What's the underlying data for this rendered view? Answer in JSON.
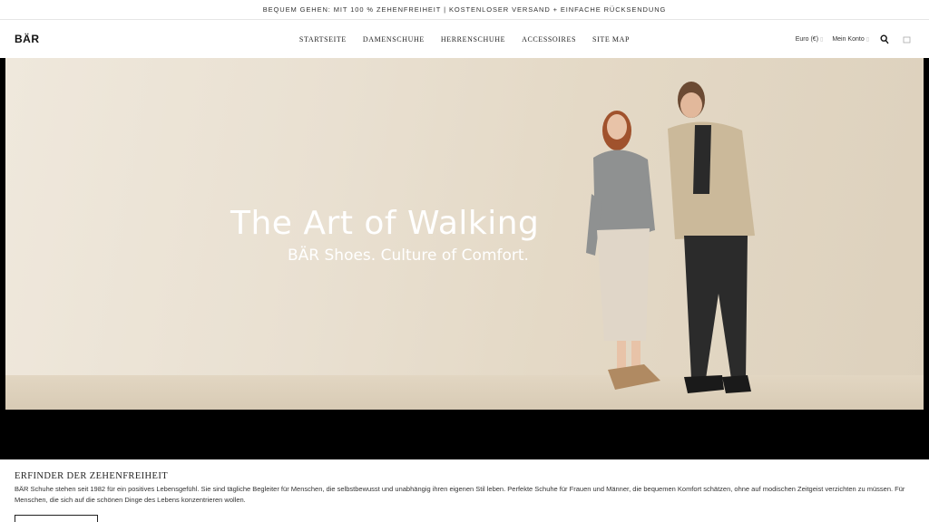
{
  "topbar": {
    "text": "BEQUEM GEHEN: MIT 100 % ZEHENFREIHEIT | KOSTENLOSER VERSAND + EINFACHE RÜCKSENDUNG"
  },
  "header": {
    "logo": "BÄR",
    "nav": [
      "STARTSEITE",
      "DAMENSCHUHE",
      "HERRENSCHUHE",
      "ACCESSOIRES",
      "SITE MAP"
    ],
    "currency": "Euro (€)",
    "account": "Mein Konto",
    "icons": [
      "search-icon",
      "cart-icon"
    ]
  },
  "hero": {
    "title": "The Art of Walking",
    "subtitle": "BÄR Shoes. Culture of Comfort."
  },
  "about": {
    "heading": "ERFINDER DER ZEHENFREIHEIT",
    "text": "BÄR Schuhe stehen seit 1982 für ein positives Lebensgefühl. Sie sind tägliche Begleiter für Menschen, die selbstbewusst und unabhängig ihren eigenen Stil leben. Perfekte Schuhe für Frauen und Männer, die bequemen Komfort schätzen, ohne auf modischen Zeitgeist verzichten zu müssen. Für Menschen, die sich auf die schönen Dinge des Lebens konzentrieren wollen."
  }
}
